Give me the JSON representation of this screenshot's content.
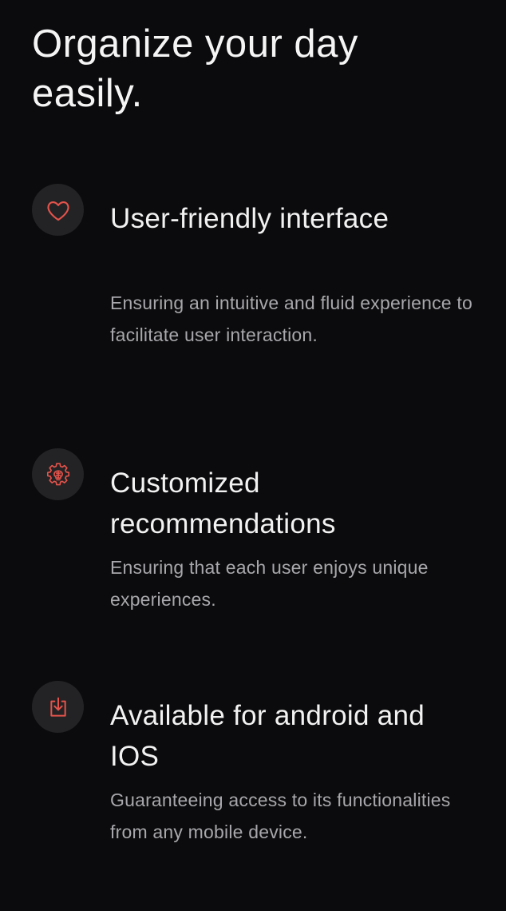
{
  "headline": "Organize your day easily.",
  "accent_color": "#e5534b",
  "features": [
    {
      "icon": "heart-icon",
      "title": "User-friendly interface",
      "description": "Ensuring an intuitive and fluid experience to facilitate user interaction."
    },
    {
      "icon": "gear-brain-icon",
      "title": "Customized recommendations",
      "description": "Ensuring that each user enjoys unique experiences."
    },
    {
      "icon": "download-icon",
      "title": "Available for android and IOS",
      "description": "Guaranteeing access to its functionalities from any mobile device."
    }
  ]
}
